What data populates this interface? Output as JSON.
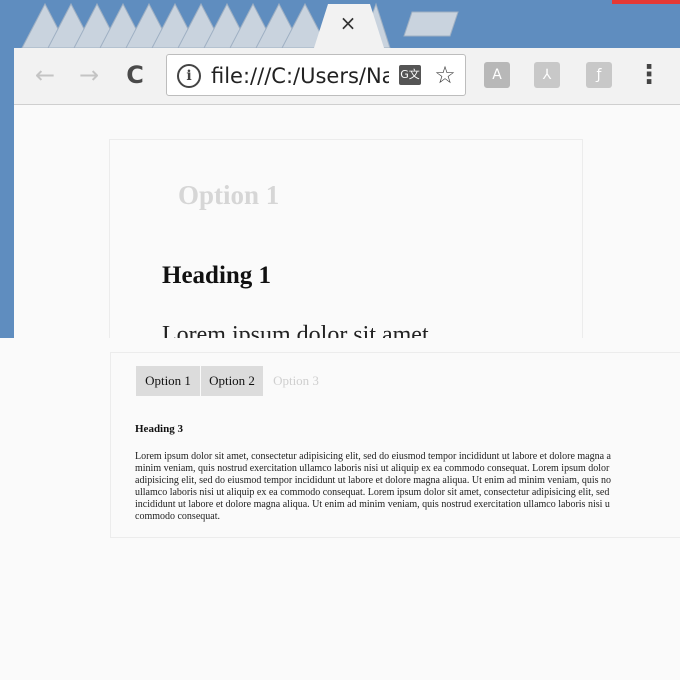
{
  "browser": {
    "url": "file:///C:/Users/Na",
    "close_glyph": "×",
    "back_glyph": "←",
    "forward_glyph": "→",
    "reload_glyph": "C",
    "info_glyph": "i",
    "translate_glyph": "G文",
    "star_glyph": "☆",
    "menu_glyph": "⋮",
    "extensions": [
      {
        "icon": "angular-extension-icon",
        "glyph": "A",
        "color": "#b8b8b8"
      },
      {
        "icon": "pdf-extension-icon",
        "glyph": "⅄",
        "color": "#c8c8c8"
      },
      {
        "icon": "flash-extension-icon",
        "glyph": "ƒ",
        "color": "#c8c8c8"
      }
    ]
  },
  "zoomed_page": {
    "tab_label": "Option 1",
    "heading": "Heading 1",
    "paragraph_start": "Lorem ipsum dolor sit amet"
  },
  "page": {
    "tabs": [
      {
        "label": "Option 1",
        "state": "active"
      },
      {
        "label": "Option 2",
        "state": "active"
      },
      {
        "label": "Option 3",
        "state": "inactive"
      }
    ],
    "heading": "Heading 3",
    "paragraph_lines": [
      "Lorem ipsum dolor sit amet, consectetur adipisicing elit, sed do eiusmod tempor incididunt ut labore et dolore magna a",
      "minim veniam, quis nostrud exercitation ullamco laboris nisi ut aliquip ex ea commodo consequat. Lorem ipsum dolor",
      "adipisicing elit, sed do eiusmod tempor incididunt ut labore et dolore magna aliqua. Ut enim ad minim veniam, quis no",
      "ullamco laboris nisi ut aliquip ex ea commodo consequat. Lorem ipsum dolor sit amet, consectetur adipisicing elit, sed",
      "incididunt ut labore et dolore magna aliqua. Ut enim ad minim veniam, quis nostrud exercitation ullamco laboris nisi u",
      "commodo consequat."
    ]
  },
  "colors": {
    "tabstrip": "#5f8dbf",
    "tab_active_bg": "#dcdcdc",
    "tab_inactive_text": "#cfcfcf"
  }
}
